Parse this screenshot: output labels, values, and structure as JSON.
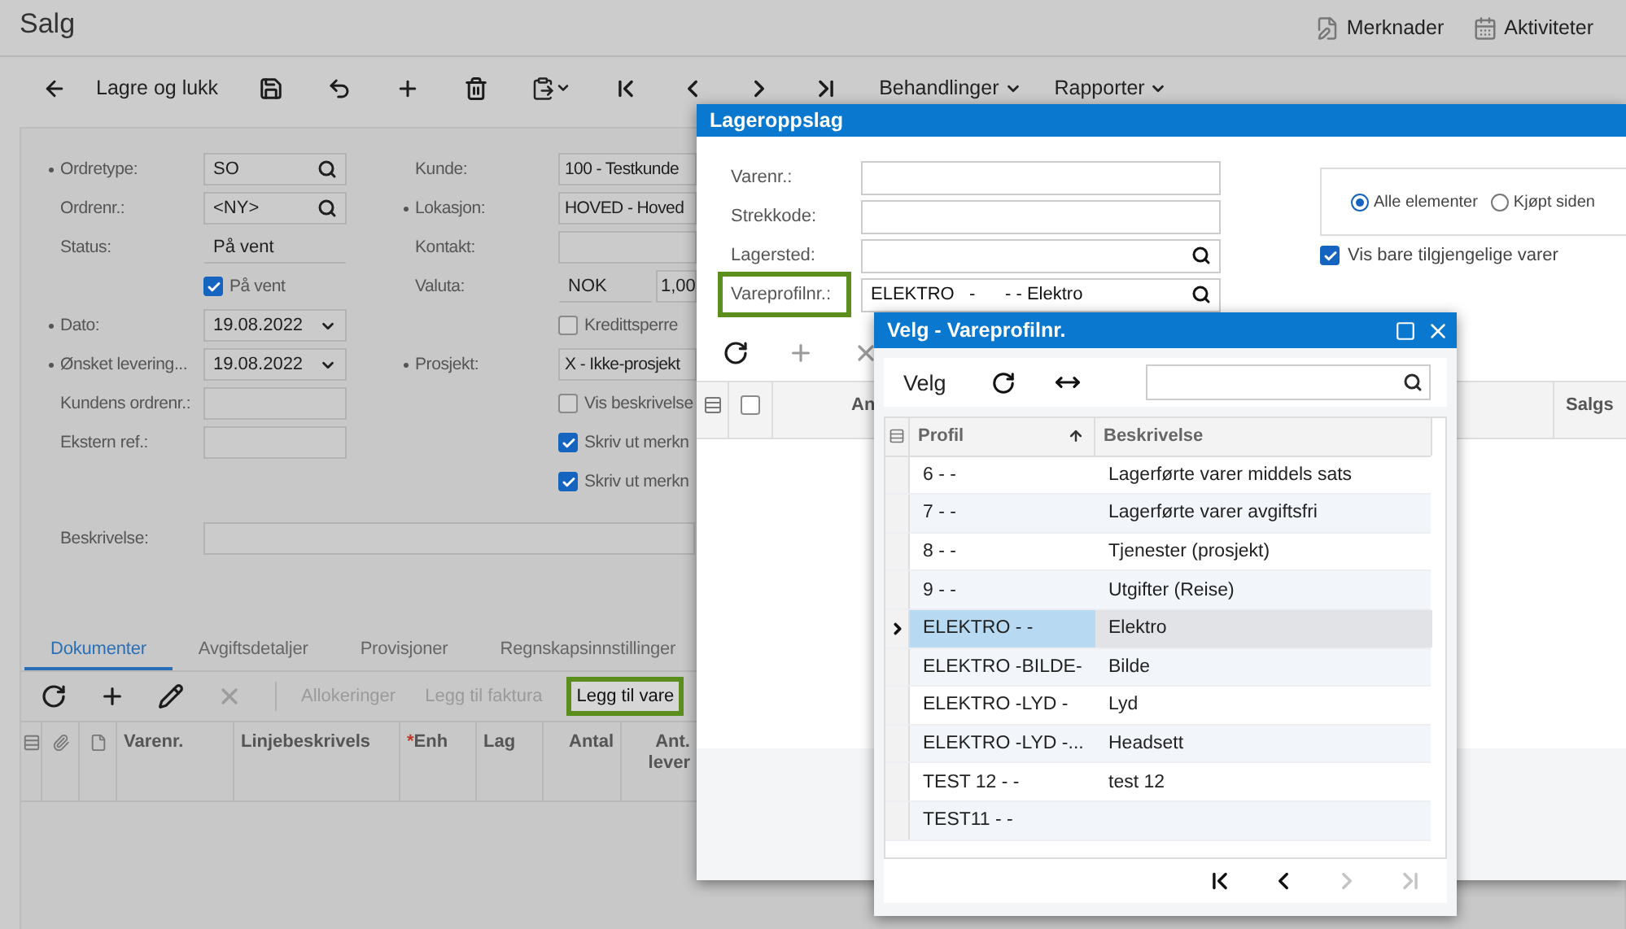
{
  "page": {
    "title": "Salg",
    "header_links": [
      {
        "label": "Merknader"
      },
      {
        "label": "Aktiviteter"
      }
    ]
  },
  "toolbar": {
    "save_close": "Lagre og lukk",
    "icon_buttons": [
      {
        "disabled": false
      },
      {
        "disabled": false
      },
      {
        "disabled": false
      },
      {
        "disabled": false
      },
      {
        "disabled": false
      }
    ],
    "nav": [
      {
        "disabled": false
      },
      {
        "disabled": false
      },
      {
        "disabled": false
      },
      {
        "disabled": false
      }
    ],
    "menus": [
      {
        "label": "Behandlinger"
      },
      {
        "label": "Rapporter"
      }
    ]
  },
  "form": {
    "left": [
      {
        "label": "Ordretype:",
        "required": true,
        "kind": "lookup",
        "value": "SO"
      },
      {
        "label": "Ordrenr.:",
        "required": false,
        "kind": "lookup",
        "value": "<NY>"
      },
      {
        "label": "Status:",
        "required": false,
        "kind": "static",
        "value": "På vent"
      },
      {
        "kind": "checkbox",
        "label": "På vent",
        "checked": true
      },
      {
        "label": "Dato:",
        "required": true,
        "kind": "date",
        "value": "19.08.2022"
      },
      {
        "label": "Ønsket levering...",
        "required": true,
        "kind": "date",
        "value": "19.08.2022"
      },
      {
        "label": "Kundens ordrenr.:",
        "required": false,
        "kind": "text"
      },
      {
        "label": "Ekstern ref.:",
        "required": false,
        "kind": "text"
      }
    ],
    "right": [
      {
        "label": "Kunde:",
        "required": false,
        "kind": "text",
        "value": "100 - Testkunde"
      },
      {
        "label": "Lokasjon:",
        "required": true,
        "kind": "text",
        "value": "HOVED - Hoved"
      },
      {
        "label": "Kontakt:",
        "required": false,
        "kind": "text"
      },
      {
        "label": "Valuta:",
        "required": false,
        "kind": "currency",
        "value": "NOK",
        "rate": "1,00"
      },
      {
        "kind": "checkbox",
        "label": "Kredittsperre",
        "checked": false
      },
      {
        "label": "Prosjekt:",
        "required": true,
        "kind": "text",
        "value": "X - Ikke-prosjekt"
      },
      {
        "kind": "checkbox",
        "label": "Vis beskrivelse",
        "checked": false
      },
      {
        "kind": "checkbox",
        "label": "Skriv ut merkn",
        "checked": true
      },
      {
        "kind": "checkbox",
        "label": "Skriv ut merkn",
        "checked": true
      }
    ],
    "description": {
      "label": "Beskrivelse:"
    }
  },
  "tabs": [
    {
      "label": "Dokumenter",
      "selected": true
    },
    {
      "label": "Avgiftsdetaljer",
      "selected": false
    },
    {
      "label": "Provisjoner",
      "selected": false
    },
    {
      "label": "Regnskapsinnstillinger",
      "selected": false
    }
  ],
  "doc_toolbar": {
    "icon_buttons": [
      {
        "disabled": false
      },
      {
        "disabled": false
      },
      {
        "disabled": false
      },
      {
        "disabled": true
      }
    ],
    "actions": [
      {
        "label": "Allokeringer",
        "disabled": true,
        "highlighted": false
      },
      {
        "label": "Legg til faktura",
        "disabled": true,
        "highlighted": false
      },
      {
        "label": "Legg til vare",
        "disabled": false,
        "highlighted": true
      }
    ]
  },
  "doc_columns": [
    {
      "label": "Varenr."
    },
    {
      "label": "Linjebeskrivels"
    },
    {
      "label": "Enh",
      "marker": "*"
    },
    {
      "label": "Lag"
    },
    {
      "label": "Antal"
    },
    {
      "label": "Ant. lever"
    }
  ],
  "lookup_dialog": {
    "title": "Lageroppslag",
    "fields": [
      {
        "label": "Varenr.:",
        "kind": "text",
        "highlighted": false
      },
      {
        "label": "Strekkode:",
        "kind": "text",
        "highlighted": false
      },
      {
        "label": "Lagersted:",
        "kind": "lookup",
        "highlighted": false
      },
      {
        "label": "Vareprofilnr.:",
        "kind": "lookup",
        "value": "ELEKTRO   -      - - Elektro",
        "highlighted": true
      }
    ],
    "filter": [
      {
        "label": "Alle elementer",
        "selected": true
      },
      {
        "label": "Kjøpt siden",
        "selected": false
      }
    ],
    "only_available": {
      "label": "Vis bare tilgjengelige varer",
      "checked": true
    },
    "grid_tools": [
      {
        "disabled": false
      },
      {
        "disabled": true
      },
      {
        "disabled": true
      }
    ],
    "header_checked": false,
    "columns": [
      {
        "label": "An"
      },
      {
        "label": "Salgs"
      }
    ]
  },
  "select_dialog": {
    "title": "Velg - Vareprofilnr.",
    "action": "Velg",
    "columns": [
      {
        "label": "Profil",
        "sorted": true
      },
      {
        "label": "Beskrivelse",
        "sorted": false
      }
    ],
    "rows": [
      {
        "profile": "6 - -",
        "description": "Lagerførte varer middels sats",
        "selected": false
      },
      {
        "profile": "7 - -",
        "description": "Lagerførte varer avgiftsfri",
        "selected": false
      },
      {
        "profile": "8 - -",
        "description": "Tjenester (prosjekt)",
        "selected": false
      },
      {
        "profile": "9 - -",
        "description": "Utgifter (Reise)",
        "selected": false
      },
      {
        "profile": "ELEKTRO - -",
        "description": "Elektro",
        "selected": true
      },
      {
        "profile": "ELEKTRO -BILDE-",
        "description": "Bilde",
        "selected": false
      },
      {
        "profile": "ELEKTRO -LYD -",
        "description": "Lyd",
        "selected": false
      },
      {
        "profile": "ELEKTRO -LYD -...",
        "description": "Headsett",
        "selected": false
      },
      {
        "profile": "TEST 12 - -",
        "description": "test 12",
        "selected": false
      },
      {
        "profile": "TEST11 - -",
        "selected": false
      }
    ],
    "pager": [
      {
        "disabled": false
      },
      {
        "disabled": false
      },
      {
        "disabled": true
      },
      {
        "disabled": true
      }
    ]
  }
}
